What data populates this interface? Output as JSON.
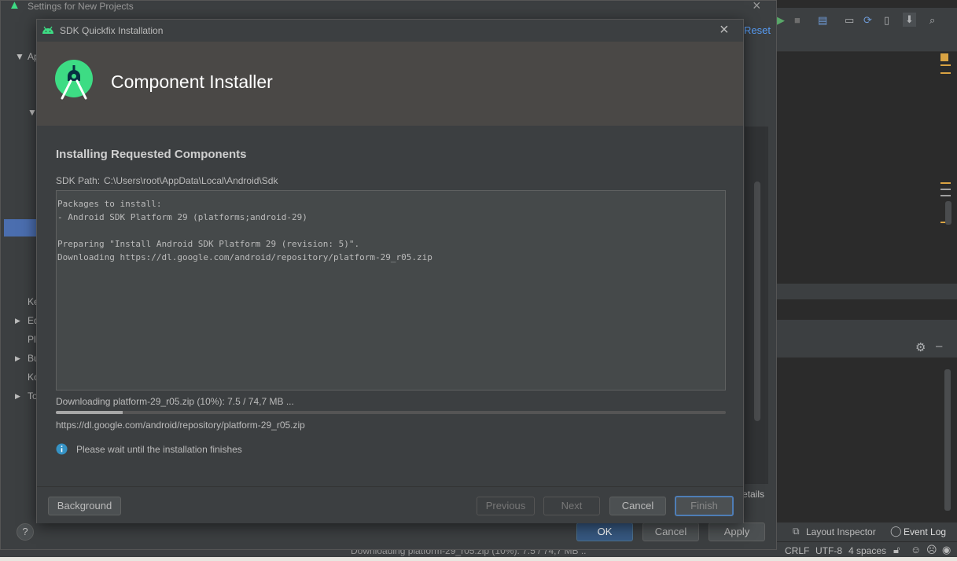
{
  "settings_window": {
    "title": "Settings for New Projects",
    "reset_label": "Reset",
    "tree_items": [
      "Ap",
      "Ke",
      "Ed",
      "Pl",
      "Bu",
      "Ko",
      "To"
    ],
    "ok_label": "OK",
    "cancel_label": "Cancel",
    "apply_label": "Apply",
    "help_label": "?",
    "partial_details_label": "etails"
  },
  "dialog": {
    "title": "SDK Quickfix Installation",
    "header_title": "Component Installer",
    "section_title": "Installing Requested Components",
    "sdk_path_label": "SDK Path:",
    "sdk_path_value": "C:\\Users\\root\\AppData\\Local\\Android\\Sdk",
    "log_lines": [
      "Packages to install:",
      "- Android SDK Platform 29 (platforms;android-29)",
      "",
      "Preparing \"Install Android SDK Platform 29 (revision: 5)\".",
      "Downloading https://dl.google.com/android/repository/platform-29_r05.zip"
    ],
    "progress_text": "Downloading platform-29_r05.zip (10%): 7.5 / 74,7 MB ...",
    "progress_fraction": 0.1,
    "url_text": "https://dl.google.com/android/repository/platform-29_r05.zip",
    "info_text": "Please wait until the installation finishes",
    "buttons": {
      "background": "Background",
      "previous": "Previous",
      "next": "Next",
      "cancel": "Cancel",
      "finish": "Finish"
    }
  },
  "ide": {
    "layout_inspector_label": "Layout Inspector",
    "event_log_label": "Event Log",
    "status_line_ending": "CRLF",
    "status_encoding": "UTF-8",
    "status_indent": "4 spaces",
    "status_background_task": "Downloading platform-29_r05.zip (10%): 7.5 / 74,7 MB ..."
  },
  "colors": {
    "android_green": "#3ddc84",
    "accent_blue": "#589df6",
    "info_blue": "#3592c4"
  }
}
